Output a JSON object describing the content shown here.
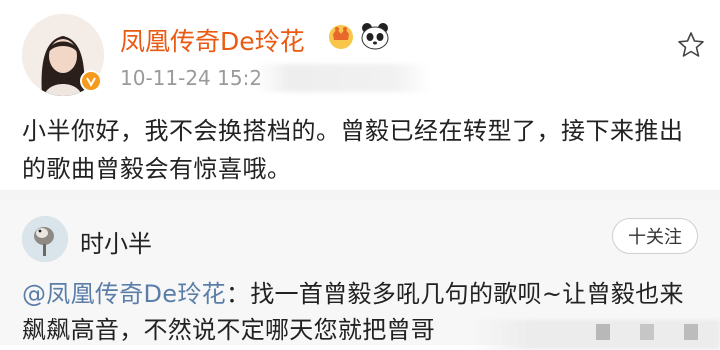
{
  "post": {
    "username": "凤凰传奇De玲花",
    "timestamp": "10-11-24 15:2",
    "text": "小半你好，我不会换搭档的。曾毅已经在转型了，接下来推出的歌曲曾毅会有惊喜哦。"
  },
  "comment": {
    "username": "时小半",
    "follow_label": "十关注",
    "mention": "@凤凰传奇De玲花",
    "text": "：找一首曾毅多吼几句的歌呗~让曾毅也来飙飙高音，不然说不定哪天您就把曾哥"
  },
  "icons": {
    "avatar": "user-avatar-photo",
    "verified": "verified-badge-icon",
    "crown": "crown-emoji-icon",
    "panda": "panda-emoji-icon",
    "star": "star-outline-icon",
    "commenter_avatar": "bird-avatar-photo"
  },
  "colors": {
    "username": "#ea5a12",
    "mention": "#5b7ea8",
    "verified": "#f59a1b"
  }
}
